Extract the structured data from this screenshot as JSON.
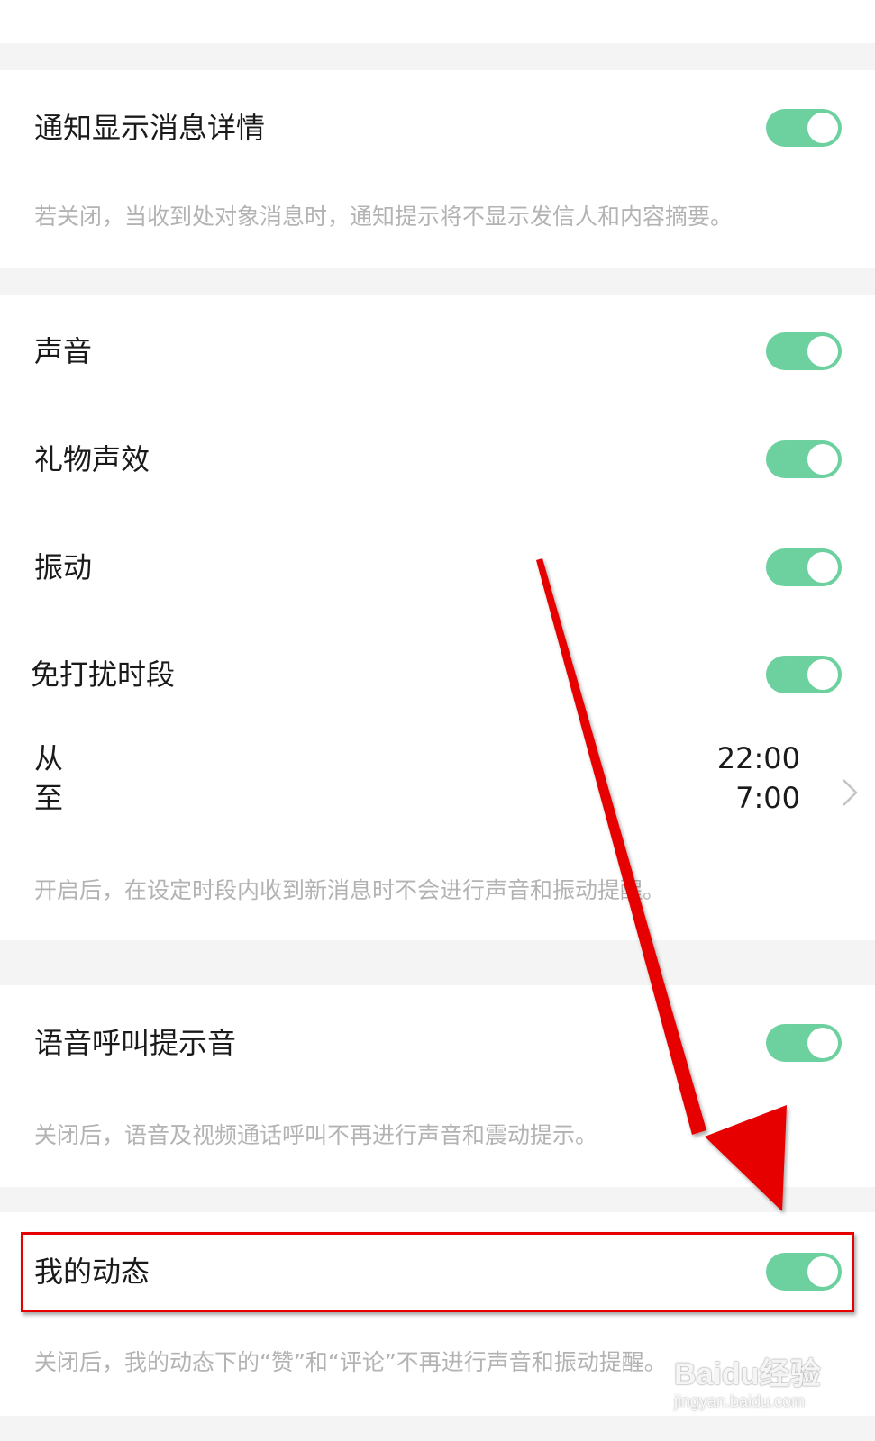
{
  "sections": {
    "notify_details": {
      "label": "通知显示消息详情",
      "enabled": true,
      "description": "若关闭，当收到处对象消息时，通知提示将不显示发信人和内容摘要。"
    },
    "sound": {
      "label": "声音",
      "enabled": true
    },
    "gift_sound": {
      "label": "礼物声效",
      "enabled": true
    },
    "vibration": {
      "label": "振动",
      "enabled": true
    },
    "dnd": {
      "label": "免打扰时段",
      "enabled": true,
      "from_label": "从",
      "from_time": "22:00",
      "to_label": "至",
      "to_time": "7:00",
      "description": "开启后，在设定时段内收到新消息时不会进行声音和振动提醒。"
    },
    "voice_call": {
      "label": "语音呼叫提示音",
      "enabled": true,
      "description": "关闭后，语音及视频通话呼叫不再进行声音和震动提示。"
    },
    "my_moments": {
      "label": "我的动态",
      "enabled": true,
      "description": "关闭后，我的动态下的“赞”和“评论”不再进行声音和振动提醒。"
    }
  },
  "watermark": {
    "main": "Baidu经验",
    "sub": "jingyan.baidu.com"
  },
  "colors": {
    "toggle_on": "#6dd19f",
    "annotation_red": "#e60000",
    "page_bg": "#f4f4f4"
  },
  "icons": {
    "chevron": "chevron-right-icon"
  }
}
